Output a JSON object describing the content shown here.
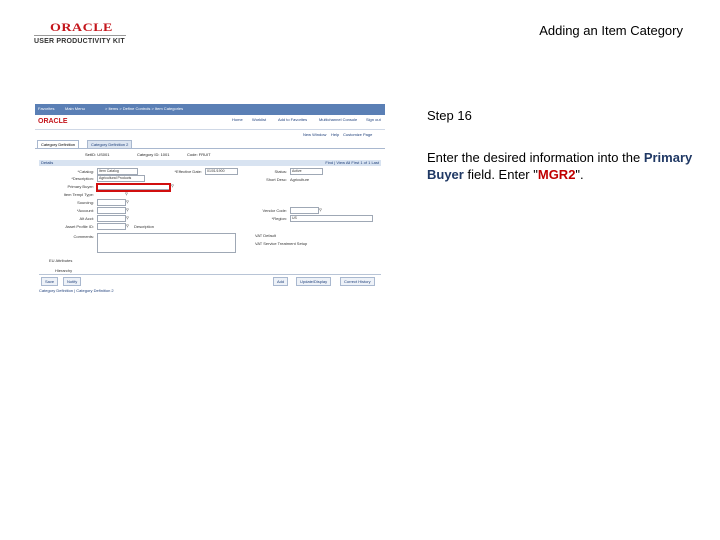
{
  "logo": {
    "word": "ORACLE",
    "tagline": "USER PRODUCTIVITY KIT"
  },
  "slide_title": "Adding an Item Category",
  "step": {
    "label": "Step 16"
  },
  "instruction": {
    "prefix": "Enter the desired information into the",
    "field_name": "Primary Buyer",
    "middle": "field. Enter \"",
    "value": "MGR2",
    "suffix": "\"."
  },
  "screenshot": {
    "nav": [
      "Favorites",
      "Main Menu",
      "> Items > Define Controls > Item Categories"
    ],
    "brand": "ORACLE",
    "brand_links": [
      "Home",
      "Worklist",
      "Add to Favorites",
      "Multichannel Console",
      "Sign out"
    ],
    "window_links": [
      "New Window",
      "Help",
      "Customize Page"
    ],
    "tabs": [
      "Category Definition",
      "Category Definition 2"
    ],
    "header": [
      "SetID: US001",
      "Category ID: 1001",
      "Code: FRUIT"
    ],
    "section": {
      "title": "Details",
      "right": "Find | View All   First 1 of 1 Last"
    },
    "labels": {
      "catalog": "*Catalog:",
      "description": "*Description:",
      "primary_buyer": "Primary Buyer:",
      "item_templ": "Item Templ Type:",
      "sourcing": "Sourcing:",
      "account": "*Account:",
      "alt_acct": "Alt Acct:",
      "asset_profile": "Asset Profile ID:",
      "comments": "Comments:",
      "effective_date": "*Effective Date:",
      "status": "Status:",
      "short_desc": "Short Desc:",
      "vendor_code": "Vendor Code:",
      "region": "*Region:"
    },
    "values": {
      "catalog": "Item Catalog",
      "description": "Agricultural Products",
      "effective_date": "01/01/1900",
      "status": "Active",
      "short_desc": "Agriculture",
      "region": "US"
    },
    "extras": {
      "description_link": "Description",
      "vat_default": "VAT Default",
      "vat_service": "VAT Service Treatment Setup",
      "attributes": "EU Attributes",
      "hierarchy": "Hierarchy"
    },
    "buttons": [
      "Save",
      "Notify",
      "Add",
      "Update/Display",
      "Correct History"
    ],
    "footer": "Category Definition | Category Definition 2"
  }
}
